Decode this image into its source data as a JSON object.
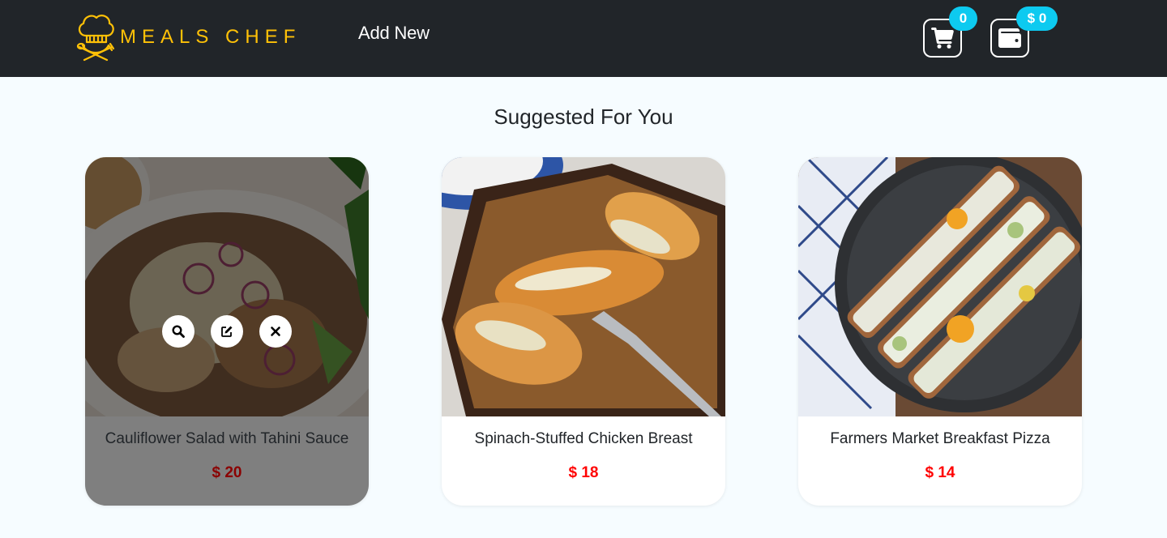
{
  "nav": {
    "brand": "MEALS CHEF",
    "add_new": "Add New",
    "cart_count": "0",
    "wallet_amount": "$ 0",
    "accent_color": "#ffc107",
    "badge_color": "#0dcaf0"
  },
  "page": {
    "title": "Suggested For You"
  },
  "meals": [
    {
      "name": "Cauliflower Salad with Tahini Sauce",
      "price": "$ 20",
      "state": "hover"
    },
    {
      "name": "Spinach-Stuffed Chicken Breast",
      "price": "$ 18"
    },
    {
      "name": "Farmers Market Breakfast Pizza",
      "price": "$ 14"
    }
  ],
  "card_actions": [
    "search-icon",
    "edit-icon",
    "close-icon"
  ],
  "colors": {
    "price": "#ff0000",
    "navbar": "#212529",
    "background": "#f6fcff"
  }
}
